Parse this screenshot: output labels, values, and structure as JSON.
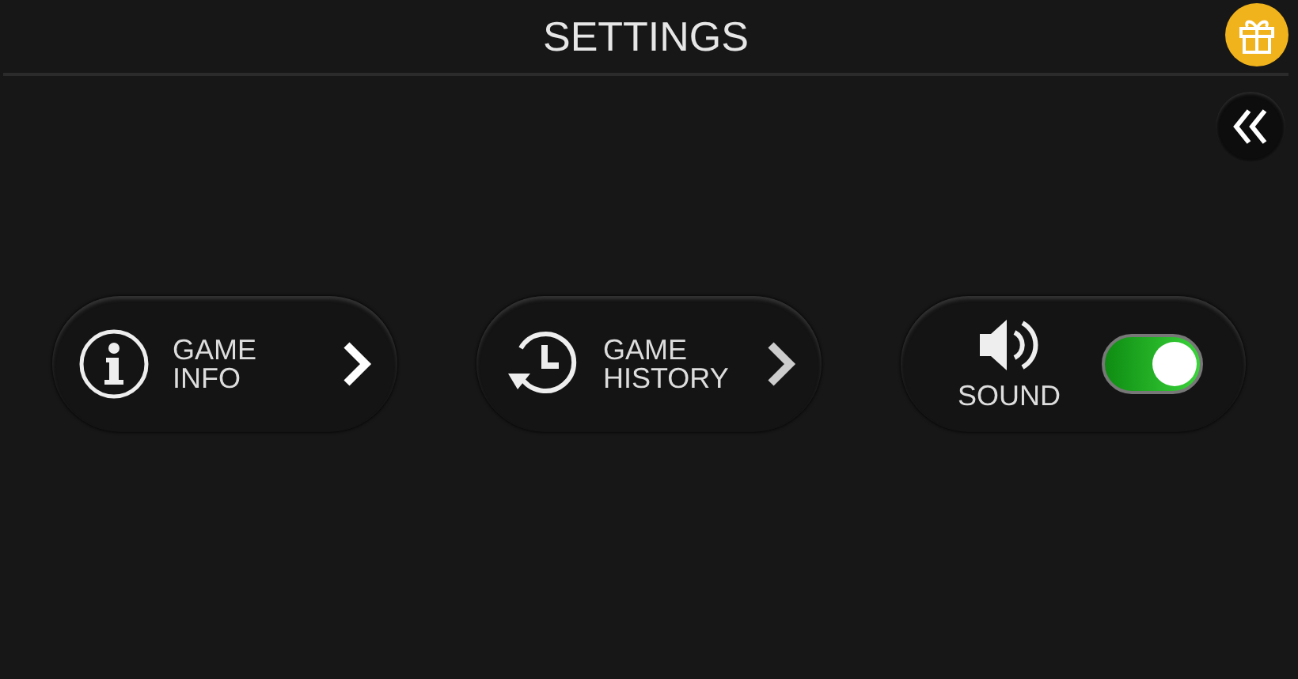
{
  "header": {
    "title": "SETTINGS"
  },
  "buttons": [
    {
      "kind": "link",
      "label": [
        "GAME",
        "INFO"
      ]
    },
    {
      "kind": "link",
      "label": [
        "GAME",
        "HISTORY"
      ]
    },
    {
      "kind": "toggle",
      "label": [
        "SOUND"
      ],
      "on": true
    }
  ]
}
